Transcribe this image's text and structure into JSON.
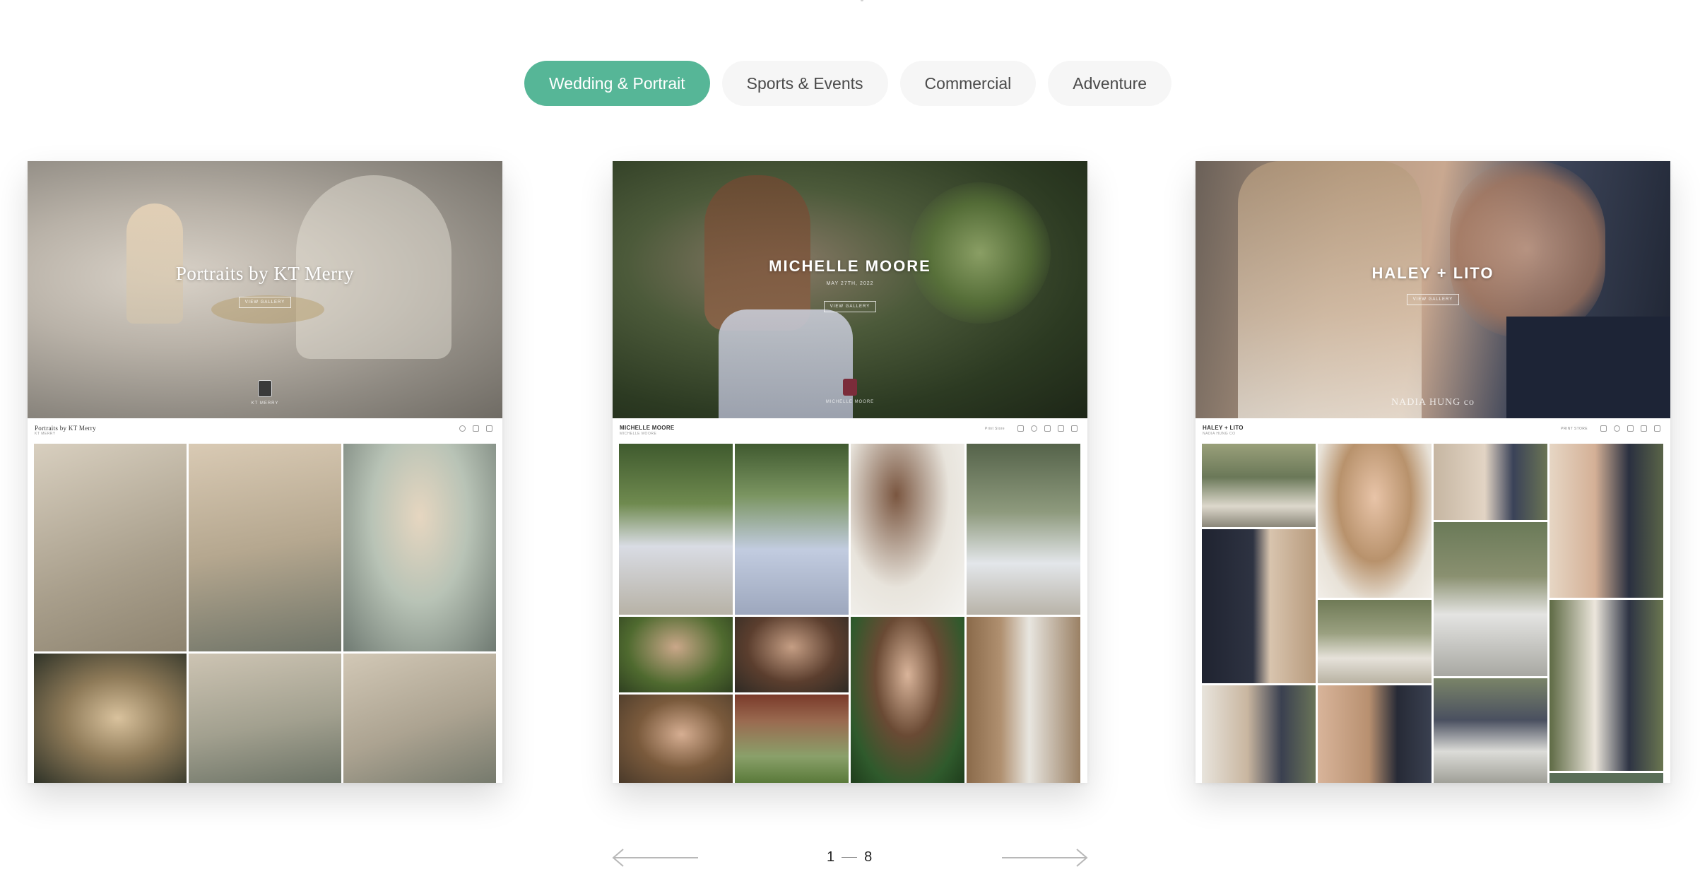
{
  "tabs": [
    {
      "label": "Wedding & Portrait",
      "active": true
    },
    {
      "label": "Sports & Events",
      "active": false
    },
    {
      "label": "Commercial",
      "active": false
    },
    {
      "label": "Adventure",
      "active": false
    }
  ],
  "colors": {
    "accent": "#56b697",
    "tab_bg": "#f6f6f6"
  },
  "cards": [
    {
      "hero_title": "Portraits by KT Merry",
      "hero_button": "VIEW GALLERY",
      "hero_caption": "KT MERRY",
      "gallery_title": "Portraits by KT Merry",
      "gallery_subtitle": "KT MERRY"
    },
    {
      "hero_title": "MICHELLE MOORE",
      "hero_date": "MAY 27TH, 2022",
      "hero_button": "VIEW GALLERY",
      "hero_caption": "MICHELLE MOORE",
      "gallery_title": "MICHELLE MOORE",
      "gallery_subtitle": "MICHELLE MOORE",
      "store_label": "Print Store"
    },
    {
      "hero_title": "HALEY + LITO",
      "hero_button": "VIEW GALLERY",
      "hero_signature": "NADIA HUNG co",
      "gallery_title": "HALEY + LITO",
      "gallery_subtitle": "NADIA HUNG CO",
      "store_label": "PRINT STORE"
    }
  ],
  "pager": {
    "current": "1",
    "total": "8"
  }
}
